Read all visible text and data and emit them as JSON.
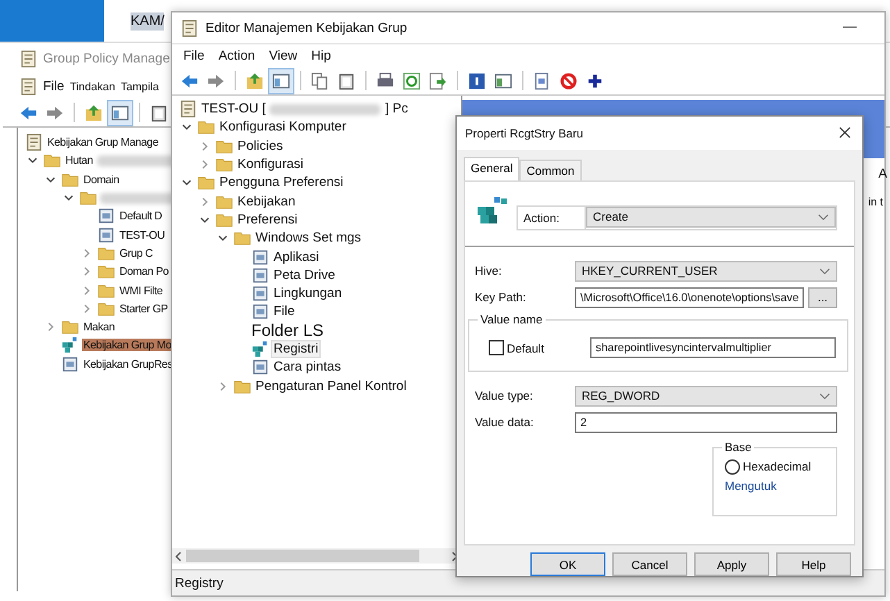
{
  "top_strip": {
    "text": "KAM/"
  },
  "gpmc": {
    "title": "Group Policy Manage",
    "menu": [
      "File",
      "Tindakan",
      "Tampila"
    ],
    "tree": [
      {
        "label": "Kebijakan Grup Manage",
        "selected": false,
        "children": [
          {
            "label": "Hutan",
            "redacted": true,
            "selected": false,
            "expanded": true,
            "children": [
              {
                "label": "Domain",
                "selected": false,
                "expanded": true,
                "children": [
                  {
                    "redacted": true,
                    "selected": false,
                    "expanded": true,
                    "children": [
                      {
                        "label": "Default D",
                        "selected": false
                      },
                      {
                        "label": "TEST-OU",
                        "selected": false
                      },
                      {
                        "label": "Grup C",
                        "selected": false,
                        "expanded": false
                      },
                      {
                        "label": "Doman Po",
                        "selected": false,
                        "expanded": false
                      },
                      {
                        "label": "WMI Filte",
                        "selected": false,
                        "expanded": false
                      },
                      {
                        "label": "Starter GP",
                        "selected": false,
                        "expanded": false
                      }
                    ]
                  }
                ]
              },
              {
                "label": "Makan",
                "selected": false,
                "expanded": false
              },
              {
                "label": "Kebijakan Grup Mo",
                "selected": true
              },
              {
                "label": "Kebijakan GrupRes",
                "selected": false
              }
            ]
          }
        ]
      }
    ]
  },
  "editor": {
    "title": "Editor Manajemen Kebijakan Grup",
    "menu": [
      "File",
      "Action",
      "View",
      "Hip"
    ],
    "tree": [
      {
        "label": "TEST-OU [",
        "redacted": true,
        "suffix": "] Pc",
        "selected": false,
        "children": [
          {
            "label": "Konfigurasi Komputer",
            "selected": false,
            "expanded": true,
            "children": [
              {
                "label": "Policies",
                "selected": false,
                "expanded": false
              },
              {
                "label": "Konfigurasi",
                "selected": false,
                "expanded": false
              }
            ]
          },
          {
            "label": "Pengguna Preferensi",
            "selected": false,
            "expanded": true,
            "children": [
              {
                "label": "Kebijakan",
                "selected": false,
                "expanded": false
              },
              {
                "label": "Preferensi",
                "selected": false,
                "expanded": true,
                "children": [
                  {
                    "label": "Windows Set mgs",
                    "selected": false,
                    "expanded": true,
                    "children": [
                      {
                        "label": "Aplikasi",
                        "selected": false
                      },
                      {
                        "label": "Peta Drive",
                        "selected": false
                      },
                      {
                        "label": "Lingkungan",
                        "selected": false
                      },
                      {
                        "label": "File",
                        "selected": false
                      },
                      {
                        "label": "Folder LS",
                        "kind": "caption",
                        "selected": false
                      },
                      {
                        "label": "Registri",
                        "selected": true
                      },
                      {
                        "label": "Cara pintas",
                        "selected": false
                      }
                    ]
                  },
                  {
                    "label": "Pengaturan Panel Kontrol",
                    "selected": false,
                    "expanded": false
                  }
                ]
              }
            ]
          }
        ]
      }
    ],
    "right_pane": {
      "heading_fragment": "A",
      "text_fragment": "in t"
    },
    "status_bar": "Registry"
  },
  "dialog": {
    "title": "Properti RcgtStry Baru",
    "tabs": [
      {
        "label": "General",
        "selected": true
      },
      {
        "label": "Common",
        "selected": false
      }
    ],
    "action": {
      "label": "Action:",
      "value": "Create"
    },
    "hive": {
      "label": "Hive:",
      "value": "HKEY_CURRENT_USER"
    },
    "key_path": {
      "label": "Key Path:",
      "value": "\\Microsoft\\Office\\16.0\\onenote\\options\\save",
      "browse": "..."
    },
    "value_name": {
      "legend": "Value name",
      "default": {
        "label": "Default",
        "checked": false
      },
      "value": "sharepointlivesyncintervalmultiplier"
    },
    "value_type": {
      "label": "Value type:",
      "value": "REG_DWORD"
    },
    "value_data": {
      "label": "Value data:",
      "value": "2"
    },
    "base": {
      "legend": "Base",
      "options": [
        {
          "label": "Hexadecimal",
          "selected": false
        }
      ],
      "note": "Mengutuk"
    },
    "buttons": [
      {
        "label": "OK",
        "default": true
      },
      {
        "label": "Cancel",
        "default": false
      },
      {
        "label": "Apply",
        "default": false
      },
      {
        "label": "Help",
        "default": false
      }
    ]
  }
}
